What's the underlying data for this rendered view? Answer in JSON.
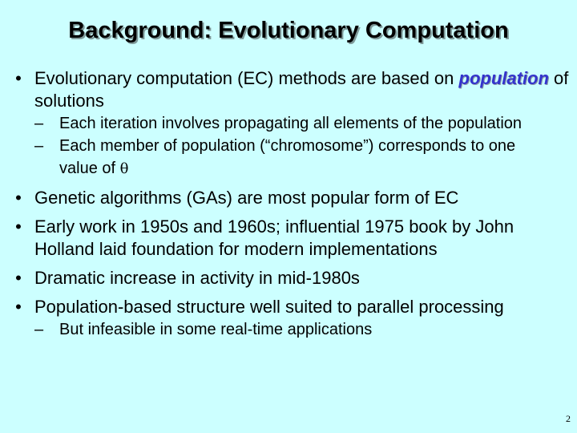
{
  "slide": {
    "title": "Background: Evolutionary Computation",
    "bullets": [
      {
        "text_before": "Evolutionary computation (EC) methods are based on ",
        "emphasis": "population",
        "text_after": " of solutions",
        "subs": [
          "Each iteration involves propagating all elements of the population",
          {
            "text": "Each member of population (“chromosome”) corresponds to one value of ",
            "symbol": "θ"
          }
        ]
      },
      {
        "text": "Genetic algorithms (GAs) are most popular form of EC"
      },
      {
        "text": "Early work in 1950s and 1960s; influential 1975 book by John Holland laid foundation for modern implementations"
      },
      {
        "text": "Dramatic increase in activity in mid-1980s"
      },
      {
        "text": "Population-based structure well suited to parallel processing",
        "subs": [
          "But infeasible in some real-time applications"
        ]
      }
    ],
    "bullet_glyph": "•",
    "dash_glyph": "–",
    "page_number": "2"
  },
  "colors": {
    "background": "#ccffff",
    "emphasis": "#3333cc",
    "text": "#000000"
  }
}
